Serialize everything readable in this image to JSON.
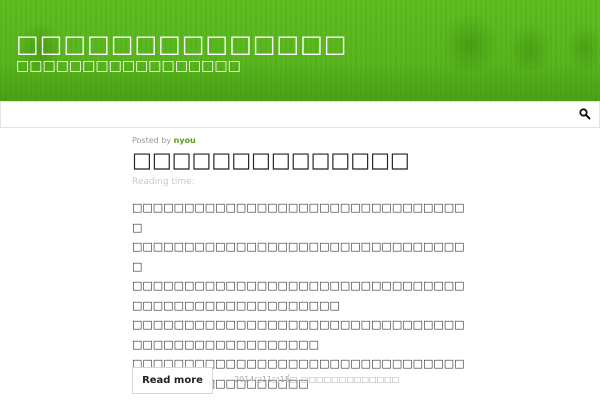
{
  "header": {
    "site_title": "□□□□□□□□□□□□□□",
    "site_description": "□□□□□□□□□□□□□□□□□",
    "background_color": "#5cbc1e"
  },
  "nav": {
    "search_icon": "search-icon"
  },
  "post": {
    "posted_by_label": "Posted by",
    "author": "nyou",
    "title": "□□□□□□□□□□□□□□",
    "reading_time_label": "Reading time:",
    "paragraphs": [
      "□□□□□□□□□□□□□□□□□□□□□□□□□□□□□□□□□",
      "□□□□□□□□□□□□□□□□□□□□□□□□□□□□□□□□□",
      "□□□□□□□□□□□□□□□□□□□□□□□□□□□□□□□□□□□□□□□□□□□□□□□□□□□□",
      "□□□□□□□□□□□□□□□□□□□□□□□□□□□□□□□□□□□□□□□□□□□□□□□□□□",
      "□□□□□□□□□□□□□□□□□□□□□□□□□□□□□□□□□□□□□□□□□□□□□□□□□"
    ],
    "read_more_label": "Read more",
    "date": "2014□11□15□",
    "separator": "/",
    "category": "□□□□□□□□□□□□□"
  }
}
